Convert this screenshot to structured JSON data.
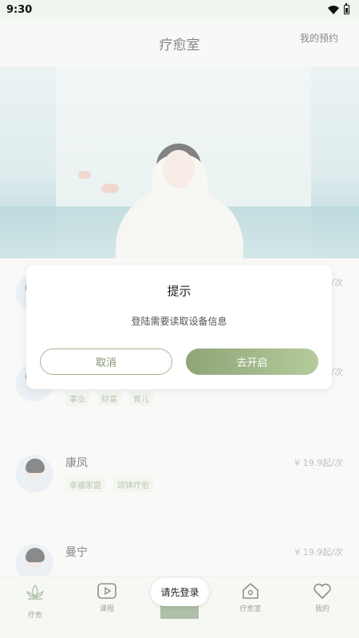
{
  "status_bar": {
    "time": "9:30",
    "icons": [
      "wifi-icon",
      "battery-icon"
    ]
  },
  "header": {
    "title": "疗愈室",
    "action": "我的预约"
  },
  "banner": {
    "image": "meditating-woman-banner"
  },
  "teachers": [
    {
      "name": "",
      "price": "/次",
      "tags": []
    },
    {
      "name": "",
      "price": "/次",
      "tags": [
        "事业",
        "财富",
        "育儿"
      ]
    },
    {
      "name": "康凤",
      "price": "¥ 19.9起/次",
      "tags": [
        "幸福家庭",
        "颂钵疗愈"
      ]
    },
    {
      "name": "曼宁",
      "price": "¥ 19.9起/次",
      "tags": []
    }
  ],
  "tabbar": {
    "items": [
      {
        "label": "疗愈",
        "icon": "lotus-icon"
      },
      {
        "label": "课程",
        "icon": "video-icon"
      },
      {
        "label": "疗愈室",
        "icon": "home-icon"
      },
      {
        "label": "我的",
        "icon": "heart-icon"
      }
    ]
  },
  "dialog": {
    "title": "提示",
    "message": "登陆需要读取设备信息",
    "cancel": "取消",
    "confirm": "去开启"
  },
  "toast": "请先登录",
  "colors": {
    "accent": "#8ea577",
    "accent_light": "#b6cb9c",
    "tag_text": "#7f9572",
    "tag_bg": "#e8eee2"
  }
}
